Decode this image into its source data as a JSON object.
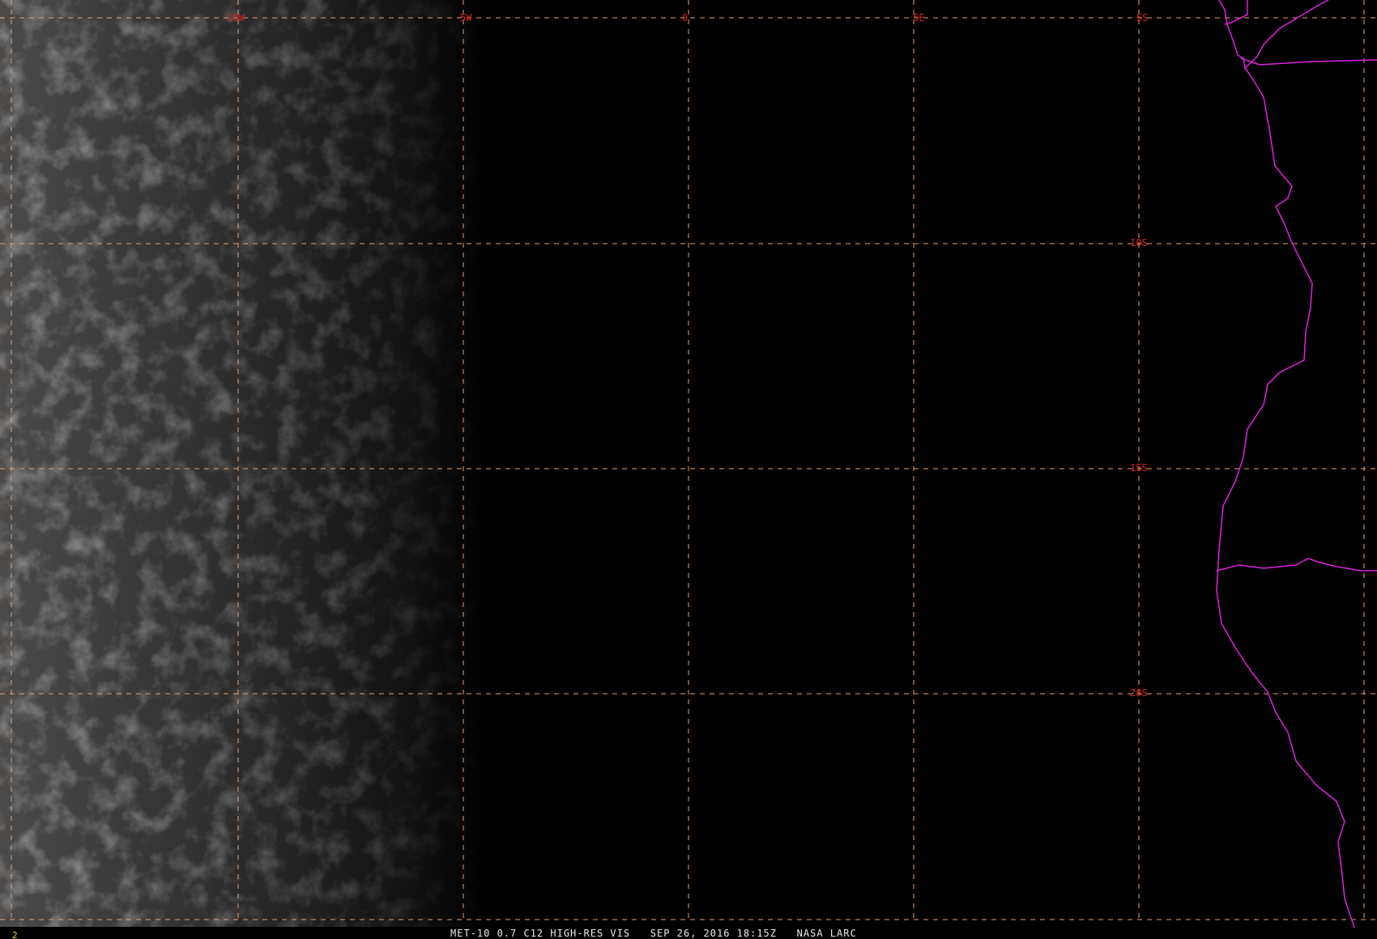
{
  "grid": {
    "line_color": "#e8a070",
    "label_color": "#d9261c",
    "longitude_labels": [
      "10W",
      "5W",
      "0",
      "5E"
    ],
    "latitude_labels": [
      "5S",
      "10S",
      "15S",
      "20S"
    ]
  },
  "coastline_color": "#e020e0",
  "caption": {
    "text": "MET-10 0.7 C12 HIGH-RES VIS   SEP 26, 2016 18:15Z   NASA LARC"
  },
  "frame_number": "2"
}
